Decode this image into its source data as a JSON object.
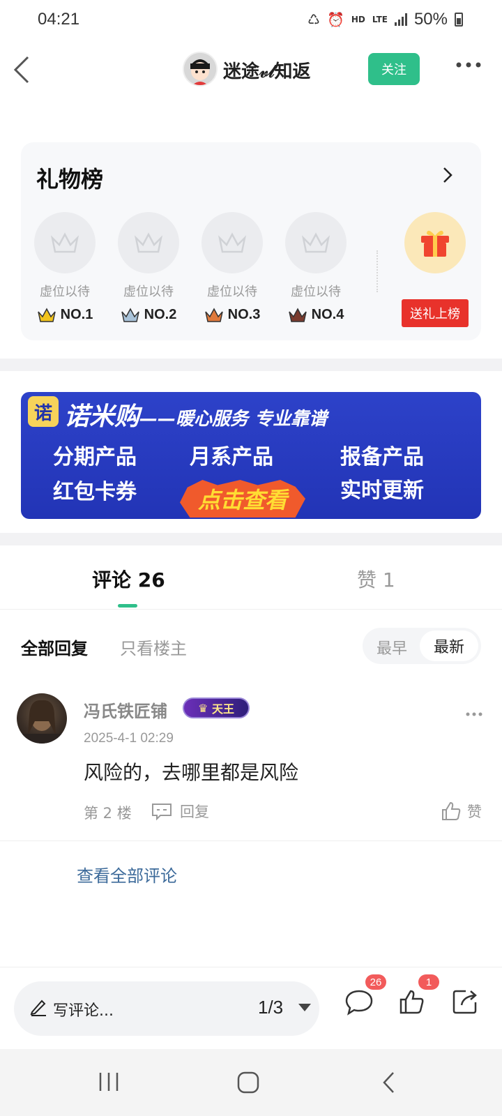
{
  "status_bar": {
    "time": "04:21",
    "network_hd": "HD",
    "network_lte": "LTE",
    "battery": "50%"
  },
  "header": {
    "back_icon": "chevron-left-icon",
    "username": "迷途𝓋𝓁知返",
    "follow_label": "关注",
    "more_icon": "more-horizontal-icon"
  },
  "gift_board": {
    "title": "礼物榜",
    "slots": [
      {
        "label": "虚位以待",
        "rank": "NO.1",
        "crown_color": "#f2c41c"
      },
      {
        "label": "虚位以待",
        "rank": "NO.2",
        "crown_color": "#a9c3d9"
      },
      {
        "label": "虚位以待",
        "rank": "NO.3",
        "crown_color": "#e07a3c"
      },
      {
        "label": "虚位以待",
        "rank": "NO.4",
        "crown_color": "#7a3b2e"
      }
    ],
    "send_label": "送礼上榜"
  },
  "banner": {
    "logo": "诺",
    "brand": "诺米购",
    "slogan": "——暖心服务 专业靠谱",
    "items": [
      "分期产品",
      "月系产品",
      "报备产品",
      "红包卡券",
      "实时更新"
    ],
    "cta": "点击查看"
  },
  "tabs": {
    "comments": "评论 26",
    "likes": "赞 1"
  },
  "filters": {
    "all": "全部回复",
    "op_only": "只看楼主",
    "sort_oldest": "最早",
    "sort_newest": "最新"
  },
  "comment": {
    "author": "冯氏铁匠铺",
    "badge": "天王",
    "time": "2025-4-1 02:29",
    "text": "风险的，去哪里都是风险",
    "floor": "第 2 楼",
    "reply_label": "回复",
    "like_label": "赞"
  },
  "view_all": "查看全部评论",
  "bottom_bar": {
    "write_placeholder": "写评论...",
    "page_indicator": "1/3",
    "comment_count": "26",
    "like_count": "1"
  },
  "colors": {
    "accent": "#2fbf8a",
    "badge_red": "#e8322b",
    "link_blue": "#3c6a9a"
  }
}
